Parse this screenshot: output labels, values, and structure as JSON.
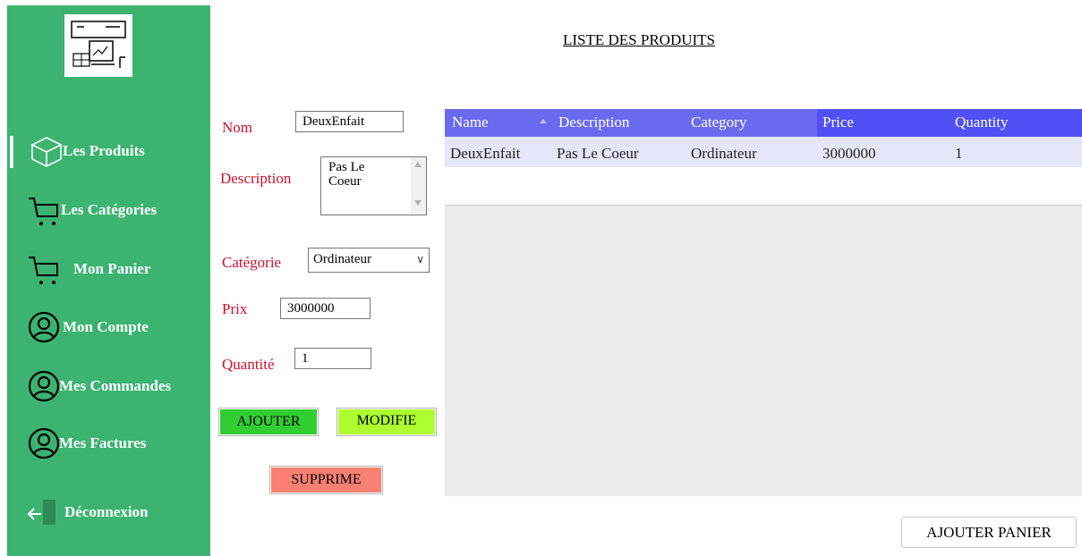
{
  "page": {
    "title": "LISTE DES PRODUITS"
  },
  "sidebar": {
    "logo_icon": "store-laptop-icon",
    "items": [
      {
        "label": "Les Produits",
        "icon": "box-icon",
        "active": true
      },
      {
        "label": "Les Catégories",
        "icon": "cart-icon"
      },
      {
        "label": "Mon Panier",
        "icon": "cart-icon"
      },
      {
        "label": "Mon Compte",
        "icon": "user-icon"
      },
      {
        "label": "Mes Commandes",
        "icon": "user-icon"
      },
      {
        "label": "Mes Factures",
        "icon": "user-icon"
      },
      {
        "label": "Déconnexion",
        "icon": "logout-icon"
      }
    ]
  },
  "form": {
    "nom_label": "Nom",
    "nom_value": "DeuxEnfait",
    "description_label": "Description",
    "description_value": "Pas Le Coeur",
    "categorie_label": "Catégorie",
    "categorie_value": "Ordinateur",
    "prix_label": "Prix",
    "prix_value": "3000000",
    "quantite_label": "Quantité",
    "quantite_value": "1"
  },
  "buttons": {
    "ajouter": "AJOUTER",
    "modifie": "MODIFIE",
    "supprime": "SUPPRIME",
    "ajouter_panier": "AJOUTER PANIER"
  },
  "grid": {
    "columns": [
      "Name",
      "Description",
      "Category",
      "Price",
      "Quantity"
    ],
    "rows": [
      [
        "DeuxEnfait",
        "Pas Le Coeur",
        "Ordinateur",
        "3000000",
        "1"
      ]
    ]
  },
  "colors": {
    "sidebar": "#3cb371",
    "header": "#6a6af0",
    "row_selected": "#e6e6fa",
    "label": "#c8102e",
    "ajouter_btn": "#32cd32",
    "modifie_btn": "#adff2f",
    "supprime_btn": "#fa8072"
  }
}
